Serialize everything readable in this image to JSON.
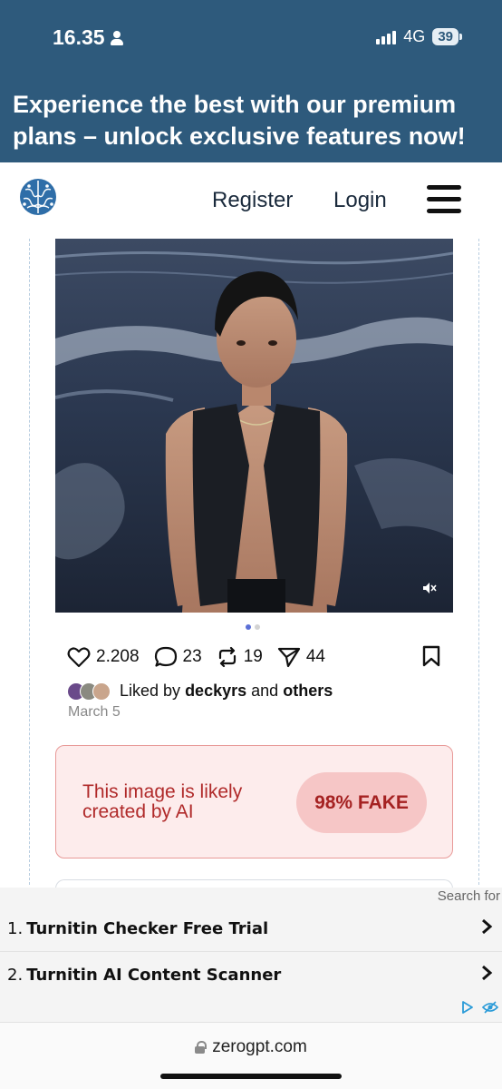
{
  "status_bar": {
    "time": "16.35",
    "network": "4G",
    "battery": "39"
  },
  "promo": {
    "text": "Experience the best with our premium plans – unlock exclusive features now!"
  },
  "nav": {
    "register_label": "Register",
    "login_label": "Login"
  },
  "post": {
    "stats": {
      "likes": "2.208",
      "comments": "23",
      "reposts": "19",
      "shares": "44"
    },
    "liked_by_prefix": "Liked by",
    "liked_by_user": "deckyrs",
    "liked_by_and": "and",
    "liked_by_others": "others",
    "date": "March 5"
  },
  "verdict": {
    "text": "This image is likely created by AI",
    "badge": "98% FAKE",
    "colors": {
      "background": "#fdecec",
      "border": "#e89a98",
      "text": "#b02a2a",
      "badge_bg": "#f6c6c6"
    }
  },
  "ad": {
    "label": "Search for",
    "items": [
      {
        "num": "1.",
        "text": "Turnitin Checker Free Trial"
      },
      {
        "num": "2.",
        "text": "Turnitin AI Content Scanner"
      }
    ]
  },
  "browser": {
    "url": "zerogpt.com"
  },
  "colors": {
    "brand": "#2e5a7c",
    "carousel_active": "#5b6fd6"
  }
}
